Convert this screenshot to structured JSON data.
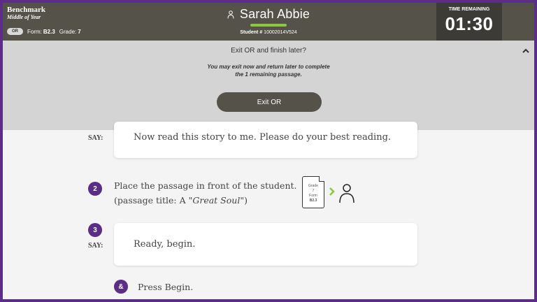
{
  "header": {
    "benchmark_title": "Benchmark",
    "benchmark_period": "Middle of Year",
    "mode_pill": "OR",
    "form_label": "Form:",
    "form_value": "B2.3",
    "grade_label": "Grade:",
    "grade_value": "7",
    "student_name": "Sarah Abbie",
    "student_id_label": "Student #",
    "student_id": "10002014V524",
    "timer_label": "TIME REMAINING",
    "timer_value": "01:30"
  },
  "exit_panel": {
    "question": "Exit OR and finish later?",
    "message_line1": "You may exit now and return later to complete",
    "message_line2": "the 1 remaining passage.",
    "exit_button": "Exit OR"
  },
  "steps": {
    "step1_label": "SAY:",
    "step1_text": "Now read this story to me. Please do your best reading.",
    "step2_number": "2",
    "step2_text": "Place the passage in front of the student.",
    "step2_title_prefix": "(passage title: A ",
    "step2_title": "\"Great Soul\"",
    "step2_title_suffix": ")",
    "doc_grade": "Grade",
    "doc_grade_value": "7",
    "doc_form": "Form",
    "doc_form_value": "B2.3",
    "step3_number": "3",
    "step3_label": "SAY:",
    "step3_text": "Ready, begin.",
    "step4_number": "&",
    "step4_text": "Press Begin."
  },
  "colors": {
    "header_bg": "#545249",
    "timer_bg": "#3c3b36",
    "accent_purple": "#5b2d86",
    "accent_green": "#8dc63f",
    "panel_bg": "#d4d4d4"
  },
  "icons": {
    "student": "person-icon",
    "collapse": "chevron-up-icon",
    "doc": "document-icon",
    "arrow": "chevron-right-icon",
    "student_large": "person-icon"
  }
}
